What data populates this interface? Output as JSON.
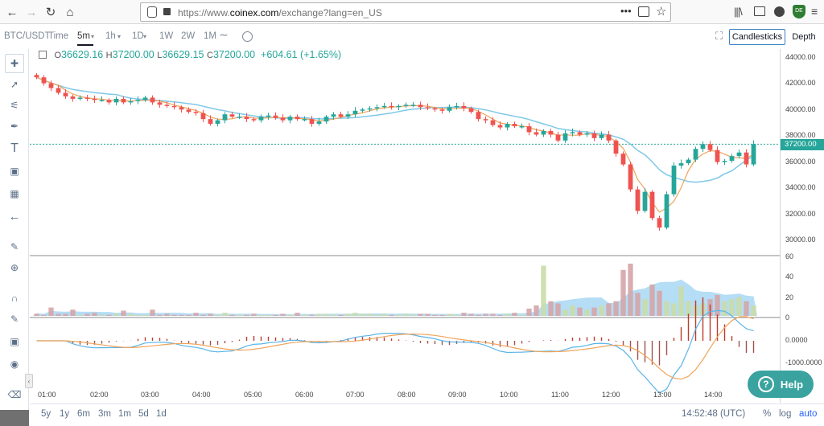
{
  "browser": {
    "url_prefix": "https://www.",
    "url_domain": "coinex.com",
    "url_path": "/exchange?lang=en_US",
    "badge": "DE"
  },
  "toolbar": {
    "symbol": "BTC/USDT",
    "time": "Time",
    "timeframes": [
      "5m",
      "1h",
      "1D",
      "1W",
      "2W",
      "1M"
    ],
    "active_timeframe": "5m",
    "candles_label": "Candlesticks",
    "depth_label": "Depth"
  },
  "legend": {
    "o_label": "O",
    "o": "36629.16",
    "h_label": "H",
    "h": "37200.00",
    "l_label": "L",
    "l": "36629.15",
    "c_label": "C",
    "c": "37200.00",
    "change": "+604.61 (+1.65%)"
  },
  "price_axis": {
    "ticks": [
      "44000.00",
      "42000.00",
      "40000.00",
      "38000.00",
      "36000.00",
      "34000.00",
      "32000.00",
      "30000.00"
    ],
    "last_price": "37200.00",
    "volume_ticks": [
      "60",
      "40",
      "20",
      "0"
    ],
    "macd_ticks": [
      "0.0000",
      "-1000.0000"
    ]
  },
  "time_axis": [
    "01:00",
    "02:00",
    "03:00",
    "04:00",
    "05:00",
    "06:00",
    "07:00",
    "08:00",
    "09:00",
    "10:00",
    "11:00",
    "12:00",
    "13:00",
    "14:00"
  ],
  "bottom": {
    "ranges": [
      "5y",
      "1y",
      "6m",
      "3m",
      "1m",
      "5d",
      "1d"
    ],
    "clock": "14:52:48 (UTC)",
    "percent": "%",
    "log": "log",
    "auto": "auto"
  },
  "help": {
    "label": "Help"
  },
  "colors": {
    "up": "#26a69a",
    "down": "#ef5350",
    "ma_long": "#7fc8e8",
    "ma_short": "#f0a35a"
  },
  "chart_data": {
    "type": "candlestick",
    "y_range": [
      29000,
      44500
    ],
    "close_series_approx": [
      42800,
      42300,
      41900,
      41500,
      41200,
      41000,
      41100,
      41000,
      40900,
      40900,
      40700,
      41000,
      40700,
      40800,
      40900,
      41100,
      40700,
      40500,
      40400,
      40300,
      40100,
      39900,
      39800,
      39300,
      38900,
      39200,
      39700,
      39500,
      39500,
      39300,
      39200,
      39500,
      39600,
      39400,
      39200,
      39500,
      39300,
      39300,
      38900,
      39100,
      39500,
      39700,
      39500,
      39700,
      40000,
      40100,
      40200,
      40300,
      40400,
      40300,
      40400,
      40500,
      40500,
      40300,
      40200,
      40100,
      40000,
      40300,
      40400,
      40200,
      39900,
      39300,
      39200,
      38800,
      38600,
      38900,
      38700,
      38700,
      38200,
      38000,
      38300,
      38000,
      37500,
      38100,
      38200,
      38000,
      38100,
      37700,
      38000,
      37500,
      36400,
      35500,
      33400,
      31600,
      33200,
      31000,
      30200,
      33000,
      35400,
      35600,
      35900,
      36800,
      37200,
      36700,
      35700,
      35800,
      36200,
      36500,
      35500,
      37200
    ],
    "volume_series_approx": [
      2,
      1,
      8,
      2,
      2,
      6,
      1,
      2,
      3,
      1,
      1,
      2,
      5,
      2,
      1,
      1,
      6,
      1,
      2,
      1,
      1,
      1,
      3,
      1,
      2,
      1,
      3,
      1,
      1,
      1,
      2,
      1,
      1,
      1,
      2,
      1,
      3,
      1,
      1,
      2,
      2,
      1,
      1,
      2,
      3,
      2,
      2,
      1,
      2,
      1,
      1,
      2,
      1,
      2,
      2,
      1,
      1,
      2,
      1,
      3,
      2,
      1,
      2,
      2,
      1,
      2,
      3,
      1,
      7,
      10,
      48,
      14,
      12,
      6,
      10,
      8,
      6,
      8,
      10,
      12,
      14,
      44,
      50,
      22,
      16,
      30,
      24,
      14,
      12,
      28,
      14,
      10,
      12,
      16,
      20,
      14,
      16,
      18,
      14,
      10
    ]
  }
}
